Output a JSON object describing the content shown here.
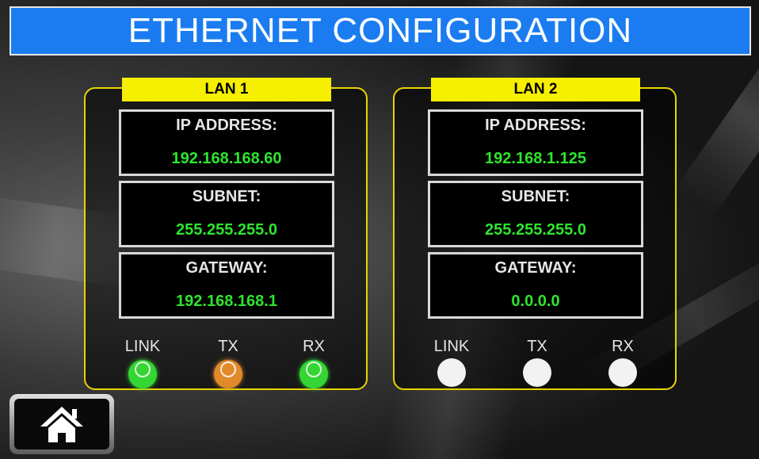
{
  "title": "ETHERNET CONFIGURATION",
  "lan1": {
    "label": "LAN 1",
    "fields": [
      {
        "label": "IP ADDRESS:",
        "value": "192.168.168.60"
      },
      {
        "label": "SUBNET:",
        "value": "255.255.255.0"
      },
      {
        "label": "GATEWAY:",
        "value": "192.168.168.1"
      }
    ],
    "indicators": [
      {
        "label": "LINK",
        "state": "on",
        "color": "#33d633"
      },
      {
        "label": "TX",
        "state": "on",
        "color": "#e08a2a"
      },
      {
        "label": "RX",
        "state": "on",
        "color": "#33d633"
      }
    ]
  },
  "lan2": {
    "label": "LAN 2",
    "fields": [
      {
        "label": "IP ADDRESS:",
        "value": "192.168.1.125"
      },
      {
        "label": "SUBNET:",
        "value": "255.255.255.0"
      },
      {
        "label": "GATEWAY:",
        "value": "0.0.0.0"
      }
    ],
    "indicators": [
      {
        "label": "LINK",
        "state": "off",
        "color": "#f2f2f2"
      },
      {
        "label": "TX",
        "state": "off",
        "color": "#f2f2f2"
      },
      {
        "label": "RX",
        "state": "off",
        "color": "#f2f2f2"
      }
    ]
  },
  "home_button": {
    "icon": "home-icon"
  },
  "colors": {
    "title_bar": "#1a7cf0",
    "panel_border": "#e8d400",
    "panel_label_bg": "#f7ef00",
    "value_text": "#2ee52e"
  }
}
